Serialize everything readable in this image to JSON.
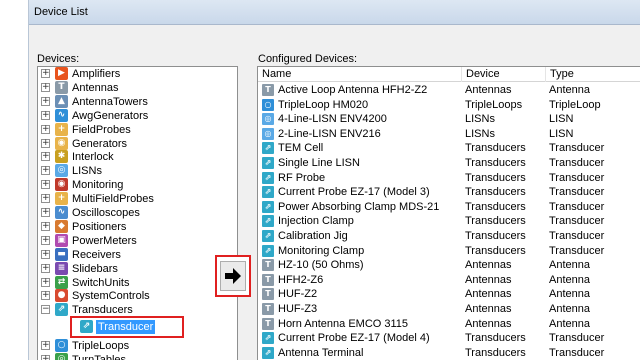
{
  "window": {
    "title": "Device List"
  },
  "devices_label": "Devices:",
  "configured_label": "Configured Devices:",
  "tree": [
    {
      "label": "Amplifiers",
      "icon": "amplifier-icon",
      "color": "#e8541e",
      "glyph": "▶"
    },
    {
      "label": "Antennas",
      "icon": "antenna-icon",
      "color": "#8a9aa8",
      "glyph": "T"
    },
    {
      "label": "AntennaTowers",
      "icon": "antenna-tower-icon",
      "color": "#6b8fb5",
      "glyph": "▲"
    },
    {
      "label": "AwgGenerators",
      "icon": "awg-generator-icon",
      "color": "#2f8fd8",
      "glyph": "∿"
    },
    {
      "label": "FieldProbes",
      "icon": "field-probe-icon",
      "color": "#e8b34a",
      "glyph": "+"
    },
    {
      "label": "Generators",
      "icon": "generator-icon",
      "color": "#e8b34a",
      "glyph": "◉"
    },
    {
      "label": "Interlock",
      "icon": "interlock-icon",
      "color": "#c8a020",
      "glyph": "✱"
    },
    {
      "label": "LISNs",
      "icon": "lisn-icon",
      "color": "#5aa9e6",
      "glyph": "◎"
    },
    {
      "label": "Monitoring",
      "icon": "monitoring-icon",
      "color": "#c0392b",
      "glyph": "◉"
    },
    {
      "label": "MultiFieldProbes",
      "icon": "multi-field-probe-icon",
      "color": "#e8b34a",
      "glyph": "+"
    },
    {
      "label": "Oscilloscopes",
      "icon": "oscilloscope-icon",
      "color": "#4a8ccf",
      "glyph": "∿"
    },
    {
      "label": "Positioners",
      "icon": "positioner-icon",
      "color": "#d87a30",
      "glyph": "◆"
    },
    {
      "label": "PowerMeters",
      "icon": "power-meter-icon",
      "color": "#b04ab0",
      "glyph": "▣"
    },
    {
      "label": "Receivers",
      "icon": "receiver-icon",
      "color": "#3a6fc0",
      "glyph": "▬"
    },
    {
      "label": "Slidebars",
      "icon": "slidebar-icon",
      "color": "#7a4ab0",
      "glyph": "≡"
    },
    {
      "label": "SwitchUnits",
      "icon": "switch-unit-icon",
      "color": "#3aa04a",
      "glyph": "⇄"
    },
    {
      "label": "SystemControls",
      "icon": "system-control-icon",
      "color": "#d84a30",
      "glyph": "●"
    },
    {
      "label": "Transducers",
      "icon": "transducer-icon",
      "color": "#2fa8c8",
      "glyph": "⇗"
    },
    {
      "label": "TripleLoops",
      "icon": "triple-loop-icon",
      "color": "#2f8fd8",
      "glyph": "○"
    },
    {
      "label": "TurnTables",
      "icon": "turntable-icon",
      "color": "#3aa04a",
      "glyph": "◎"
    }
  ],
  "tree_child": {
    "label": "Transducer",
    "icon": "transducer-icon"
  },
  "columns": [
    "Name",
    "Device",
    "Type"
  ],
  "rows": [
    {
      "name": "Active Loop Antenna HFH2-Z2",
      "device": "Antennas",
      "type": "Antenna",
      "icon": "antenna-icon",
      "color": "#8a9aa8",
      "glyph": "T"
    },
    {
      "name": "TripleLoop HM020",
      "device": "TripleLoops",
      "type": "TripleLoop",
      "icon": "triple-loop-icon",
      "color": "#2f8fd8",
      "glyph": "○"
    },
    {
      "name": "4-Line-LISN ENV4200",
      "device": "LISNs",
      "type": "LISN",
      "icon": "lisn-icon",
      "color": "#5aa9e6",
      "glyph": "◎"
    },
    {
      "name": "2-Line-LISN ENV216",
      "device": "LISNs",
      "type": "LISN",
      "icon": "lisn-icon",
      "color": "#5aa9e6",
      "glyph": "◎"
    },
    {
      "name": "TEM Cell",
      "device": "Transducers",
      "type": "Transducer",
      "icon": "transducer-icon",
      "color": "#2fa8c8",
      "glyph": "⇗"
    },
    {
      "name": "Single Line LISN",
      "device": "Transducers",
      "type": "Transducer",
      "icon": "transducer-icon",
      "color": "#2fa8c8",
      "glyph": "⇗"
    },
    {
      "name": "RF Probe",
      "device": "Transducers",
      "type": "Transducer",
      "icon": "transducer-icon",
      "color": "#2fa8c8",
      "glyph": "⇗"
    },
    {
      "name": "Current Probe EZ-17 (Model 3)",
      "device": "Transducers",
      "type": "Transducer",
      "icon": "transducer-icon",
      "color": "#2fa8c8",
      "glyph": "⇗"
    },
    {
      "name": "Power Absorbing Clamp MDS-21",
      "device": "Transducers",
      "type": "Transducer",
      "icon": "transducer-icon",
      "color": "#2fa8c8",
      "glyph": "⇗"
    },
    {
      "name": "Injection Clamp",
      "device": "Transducers",
      "type": "Transducer",
      "icon": "transducer-icon",
      "color": "#2fa8c8",
      "glyph": "⇗"
    },
    {
      "name": "Calibration Jig",
      "device": "Transducers",
      "type": "Transducer",
      "icon": "transducer-icon",
      "color": "#2fa8c8",
      "glyph": "⇗"
    },
    {
      "name": "Monitoring Clamp",
      "device": "Transducers",
      "type": "Transducer",
      "icon": "transducer-icon",
      "color": "#2fa8c8",
      "glyph": "⇗"
    },
    {
      "name": "HZ-10 (50 Ohms)",
      "device": "Antennas",
      "type": "Antenna",
      "icon": "antenna-icon",
      "color": "#8a9aa8",
      "glyph": "T"
    },
    {
      "name": "HFH2-Z6",
      "device": "Antennas",
      "type": "Antenna",
      "icon": "antenna-icon",
      "color": "#8a9aa8",
      "glyph": "T"
    },
    {
      "name": "HUF-Z2",
      "device": "Antennas",
      "type": "Antenna",
      "icon": "antenna-icon",
      "color": "#8a9aa8",
      "glyph": "T"
    },
    {
      "name": "HUF-Z3",
      "device": "Antennas",
      "type": "Antenna",
      "icon": "antenna-icon",
      "color": "#8a9aa8",
      "glyph": "T"
    },
    {
      "name": "Horn Antenna EMCO 3115",
      "device": "Antennas",
      "type": "Antenna",
      "icon": "antenna-icon",
      "color": "#8a9aa8",
      "glyph": "T"
    },
    {
      "name": "Current Probe EZ-17 (Model 4)",
      "device": "Transducers",
      "type": "Transducer",
      "icon": "transducer-icon",
      "color": "#2fa8c8",
      "glyph": "⇗"
    },
    {
      "name": "Antenna Terminal",
      "device": "Transducers",
      "type": "Transducer",
      "icon": "transducer-icon",
      "color": "#2fa8c8",
      "glyph": "⇗"
    }
  ]
}
